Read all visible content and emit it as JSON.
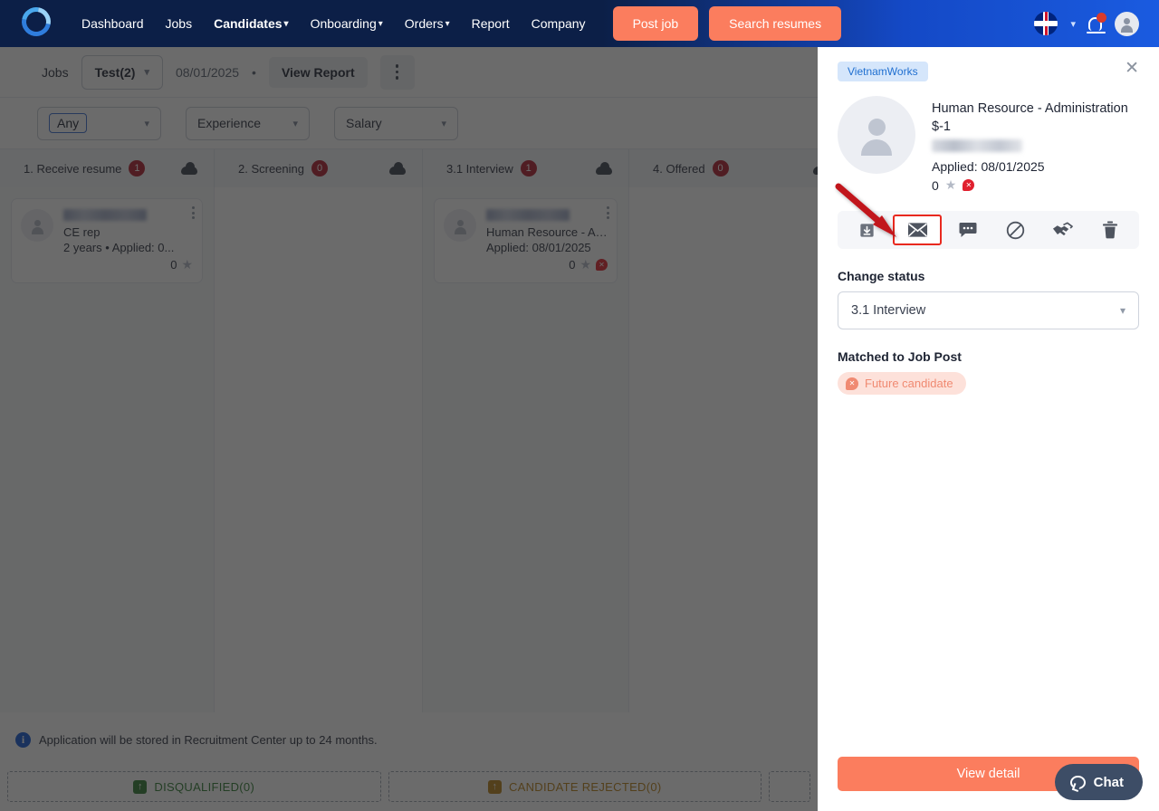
{
  "navbar": {
    "logo_name": "company-logo",
    "links": [
      {
        "label": "Dashboard",
        "has_caret": false,
        "active": false
      },
      {
        "label": "Jobs",
        "has_caret": false,
        "active": false
      },
      {
        "label": "Candidates",
        "has_caret": true,
        "active": true
      },
      {
        "label": "Onboarding",
        "has_caret": true,
        "active": false
      },
      {
        "label": "Orders",
        "has_caret": true,
        "active": false
      },
      {
        "label": "Report",
        "has_caret": false,
        "active": false
      },
      {
        "label": "Company",
        "has_caret": false,
        "active": false
      }
    ],
    "post_job_label": "Post job",
    "search_resumes_label": "Search resumes",
    "language_icon": "uk-flag-icon",
    "notification_icon": "bell-icon",
    "account_icon": "user-avatar-icon",
    "accent_color": "#fb7d5e"
  },
  "toolbar": {
    "jobs_label": "Jobs",
    "job_selected": "Test(2)",
    "date": "08/01/2025",
    "separator": "•",
    "view_report_label": "View Report",
    "more_icon": "kebab-menu-icon"
  },
  "filters": [
    {
      "label": "Any",
      "chip": true
    },
    {
      "label": "Experience",
      "chip": false
    },
    {
      "label": "Salary",
      "chip": false
    }
  ],
  "kanban": {
    "columns": [
      {
        "title": "1. Receive resume",
        "count": "1",
        "upload_icon": "cloud-upload-icon"
      },
      {
        "title": "2. Screening",
        "count": "0",
        "upload_icon": "cloud-upload-icon"
      },
      {
        "title": "3.1 Interview",
        "count": "1",
        "upload_icon": "cloud-upload-icon"
      },
      {
        "title": "4. Offered",
        "count": "0",
        "upload_icon": "cloud-upload-icon"
      }
    ],
    "cards": [
      {
        "column": 0,
        "name_redacted": true,
        "title": "CE rep",
        "meta": "2 years  •  Applied: 0...",
        "rating": "0",
        "has_flag": false
      },
      {
        "column": 2,
        "name_redacted": true,
        "title": "Human Resource - Ad...",
        "meta": "Applied: 08/01/2025",
        "rating": "0",
        "has_flag": true
      }
    ]
  },
  "notice": {
    "icon": "info-icon",
    "text": "Application will be stored in Recruitment Center up to 24 months."
  },
  "dropzones": [
    {
      "label": "DISQUALIFIED(0)",
      "color": "#2f7d32",
      "icon": "up-arrow-icon"
    },
    {
      "label": "CANDIDATE REJECTED(0)",
      "color": "#b9801a",
      "icon": "up-arrow-icon"
    },
    {
      "label": "",
      "color": "#9ba3b1",
      "icon": ""
    }
  ],
  "panel": {
    "source_tag": "VietnamWorks",
    "close_icon": "close-icon",
    "avatar_icon": "user-avatar-icon",
    "candidate_title": "Human Resource - Administration",
    "salary": "$-1",
    "name_redacted": true,
    "applied": "Applied: 08/01/2025",
    "rating": "0",
    "star_icon": "star-icon",
    "flag_icon": "red-flag-icon",
    "actions": [
      {
        "name": "download-icon",
        "title": "Download"
      },
      {
        "name": "envelope-icon",
        "title": "Send email",
        "highlighted": true
      },
      {
        "name": "chat-bubble-icon",
        "title": "Comment"
      },
      {
        "name": "ban-icon",
        "title": "Block"
      },
      {
        "name": "handshake-icon",
        "title": "Hire"
      },
      {
        "name": "trash-icon",
        "title": "Delete"
      }
    ],
    "change_status_label": "Change status",
    "status_value": "3.1 Interview",
    "status_caret_icon": "chevron-down-icon",
    "matched_label": "Matched to Job Post",
    "matched_chip": "Future candidate",
    "matched_chip_icon": "red-flag-icon",
    "view_detail_label": "View detail",
    "highlight_color": "#e8291f"
  },
  "chat": {
    "label": "Chat",
    "icon": "chat-bubble-icon"
  }
}
